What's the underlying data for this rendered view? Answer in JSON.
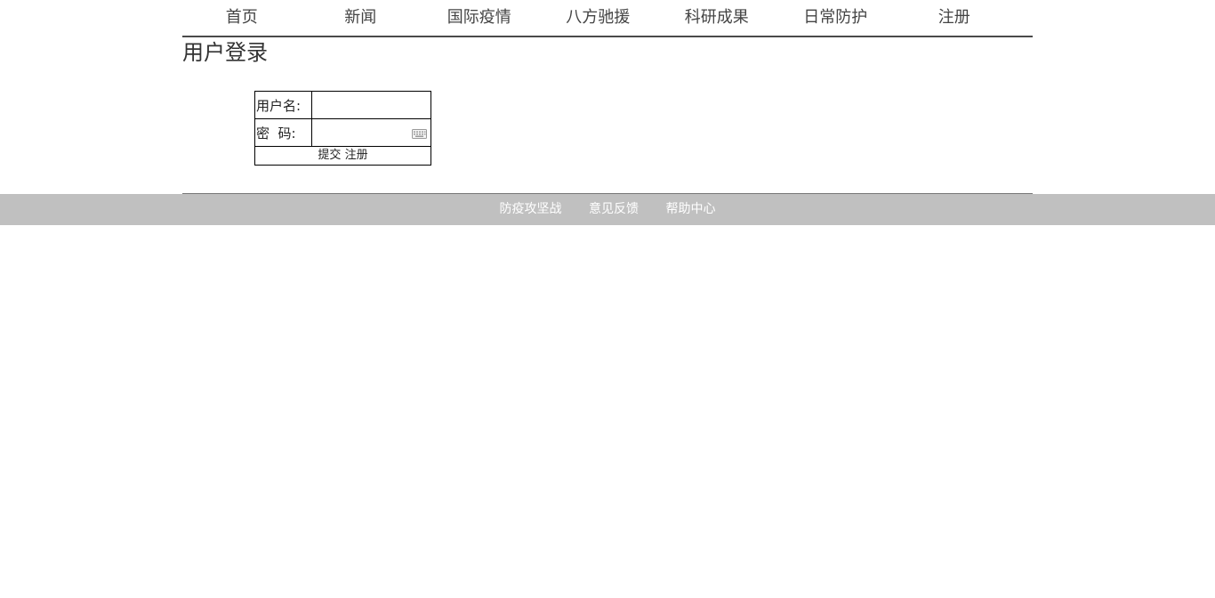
{
  "nav": {
    "items": [
      {
        "label": "首页"
      },
      {
        "label": "新闻"
      },
      {
        "label": "国际疫情"
      },
      {
        "label": "八方驰援"
      },
      {
        "label": "科研成果"
      },
      {
        "label": "日常防护"
      },
      {
        "label": "注册"
      }
    ]
  },
  "page": {
    "title": "用户登录"
  },
  "login": {
    "username_label": "用户名:",
    "username_value": "",
    "password_label": "密  码:",
    "password_value": "",
    "submit_label": "提交",
    "register_label": "注册"
  },
  "footer": {
    "links": [
      {
        "label": "防疫攻坚战"
      },
      {
        "label": "意见反馈"
      },
      {
        "label": "帮助中心"
      }
    ]
  },
  "icons": {
    "password_field_icon": "keyboard-icon"
  },
  "colors": {
    "footer_bg": "#c0c0c0",
    "footer_text": "#ffffff",
    "nav_rule": "#4a4a4a"
  }
}
